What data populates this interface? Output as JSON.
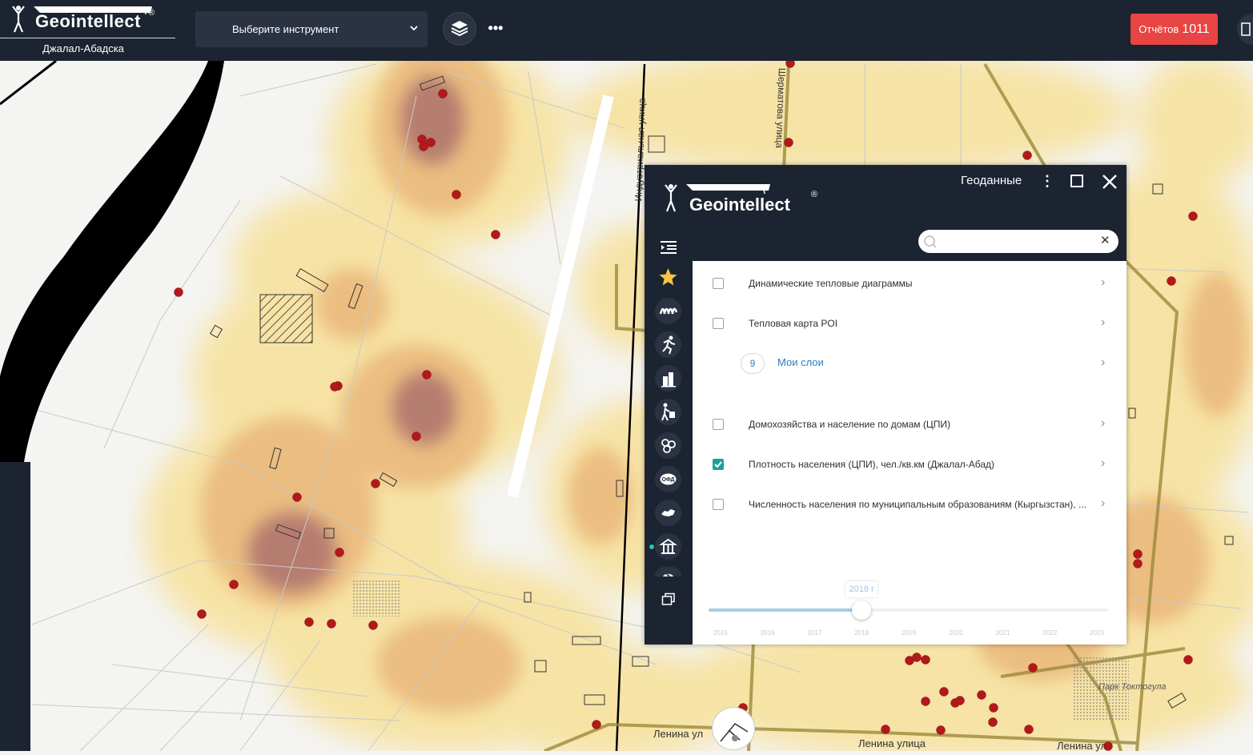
{
  "brand": {
    "name": "Geointellect",
    "reg": "®",
    "city": "Джалал-Абадска"
  },
  "toolbar": {
    "tool_select_label": "Выберите инструмент",
    "layers_icon": "layers-icon",
    "more_label": "•••"
  },
  "reports": {
    "label": "Отчётов",
    "count": "1011"
  },
  "map": {
    "street_labels": [
      {
        "text": "Индустриальная улица",
        "name": "street-label-industrialnaya"
      },
      {
        "text": "Шерматова улица",
        "name": "street-label-shermatova"
      },
      {
        "text": "Ленина ул",
        "name": "street-label-lenina-1"
      },
      {
        "text": "Ленина улица",
        "name": "street-label-lenina-2"
      },
      {
        "text": "Ленина ул",
        "name": "street-label-lenina-3"
      },
      {
        "text": "Парк Токтогула",
        "name": "park-label-toktogula"
      }
    ],
    "colors": {
      "heat_low": "#f7e3a1",
      "heat_mid": "#eab77a",
      "heat_high": "#a4676a",
      "poi": "#b3191a",
      "road_major": "#9c8a3a"
    }
  },
  "panel": {
    "title": "Геоданные",
    "search": {
      "placeholder": "",
      "value": ""
    },
    "sidebar_icons": [
      "menu-icon",
      "star-icon",
      "wave-icon",
      "runner-icon",
      "buildings-icon",
      "pedestrian-icon",
      "hexagons-icon",
      "ofd-icon",
      "map-region-icon",
      "bank-icon",
      "dollar-icon",
      "copy-icon"
    ],
    "ofd_text": "ОФД",
    "dollar_text": "$",
    "layers": [
      {
        "label": "Динамические тепловые диаграммы",
        "checked": false,
        "name": "layer-dynamic-heatmaps"
      },
      {
        "label": "Тепловая карта POI",
        "checked": false,
        "name": "layer-poi-heatmap"
      },
      {
        "label": "Мои слои",
        "count": "9",
        "name": "layer-my-layers"
      },
      {
        "label": "Домохозяйства и население по домам (ЦПИ)",
        "checked": false,
        "name": "layer-households"
      },
      {
        "label": "Плотность населения (ЦПИ), чел./кв.км (Джалал-Абад)",
        "checked": true,
        "name": "layer-population-density"
      },
      {
        "label": "Численность населения по муниципальным образованиям (Кыргызстан), ...",
        "checked": false,
        "name": "layer-population-municipal"
      }
    ],
    "timeline": {
      "current_label": "2018 г",
      "current": "2018",
      "years": [
        "2015",
        "2016",
        "2017",
        "2018",
        "2019",
        "2020",
        "2021",
        "2022",
        "2023"
      ]
    }
  }
}
